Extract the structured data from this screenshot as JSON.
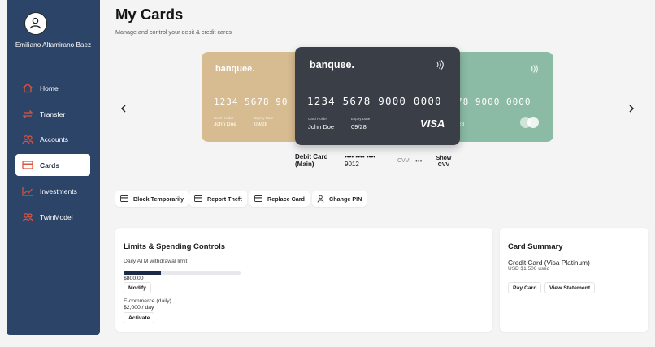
{
  "user": {
    "name": "Emiliano Altamirano Baez"
  },
  "nav": {
    "items": [
      {
        "label": "Home",
        "icon": "home-icon"
      },
      {
        "label": "Transfer",
        "icon": "transfer-icon"
      },
      {
        "label": "Accounts",
        "icon": "accounts-icon"
      },
      {
        "label": "Cards",
        "icon": "card-icon",
        "active": true
      },
      {
        "label": "Investments",
        "icon": "chart-icon"
      },
      {
        "label": "TwinModel",
        "icon": "twinmodel-icon"
      }
    ]
  },
  "header": {
    "title": "My Cards",
    "subtitle": "Manage and control your debit & credit cards"
  },
  "cards": {
    "left": {
      "brand": "banquee.",
      "number": "1234 5678 90",
      "holder_label": "Card Holder",
      "holder": "John Doe",
      "expiry_label": "Expiry Date",
      "expiry": "09/28"
    },
    "main": {
      "brand": "banquee.",
      "number": "1234 5678 9000 0000",
      "holder_label": "Card Holder",
      "holder": "John Doe",
      "expiry_label": "Expiry Date",
      "expiry": "09/28",
      "network": "VISA"
    },
    "right": {
      "number": "78 9000 0000",
      "expiry": "28"
    },
    "colors": {
      "left": "#d8bc91",
      "main": "#3a3e46",
      "right": "#8bbba4"
    }
  },
  "selected_card": {
    "type_line1": "Debit Card",
    "type_line2": "(Main)",
    "masked_line1": "•••• •••• ••••",
    "masked_line2": "9012",
    "cvv_label": "CVV:",
    "cvv_value": "•••",
    "show_cvv_line1": "Show",
    "show_cvv_line2": "CVV"
  },
  "actions": {
    "block": "Block Temporarily",
    "theft": "Report Theft",
    "replace": "Replace Card",
    "pin": "Change PIN"
  },
  "limits": {
    "title": "Limits & Spending Controls",
    "atm_label": "Daily ATM withdrawal limit",
    "atm_value": "$800.00",
    "atm_progress": 0.32,
    "modify": "Modify",
    "ecom_label": "E-commerce (daily)",
    "ecom_value": "$2,000 / day",
    "activate": "Activate"
  },
  "summary": {
    "title": "Card Summary",
    "type": "Credit Card (Visa Platinum)",
    "used": "USD $1,500 used",
    "pay": "Pay Card",
    "statement": "View Statement"
  }
}
